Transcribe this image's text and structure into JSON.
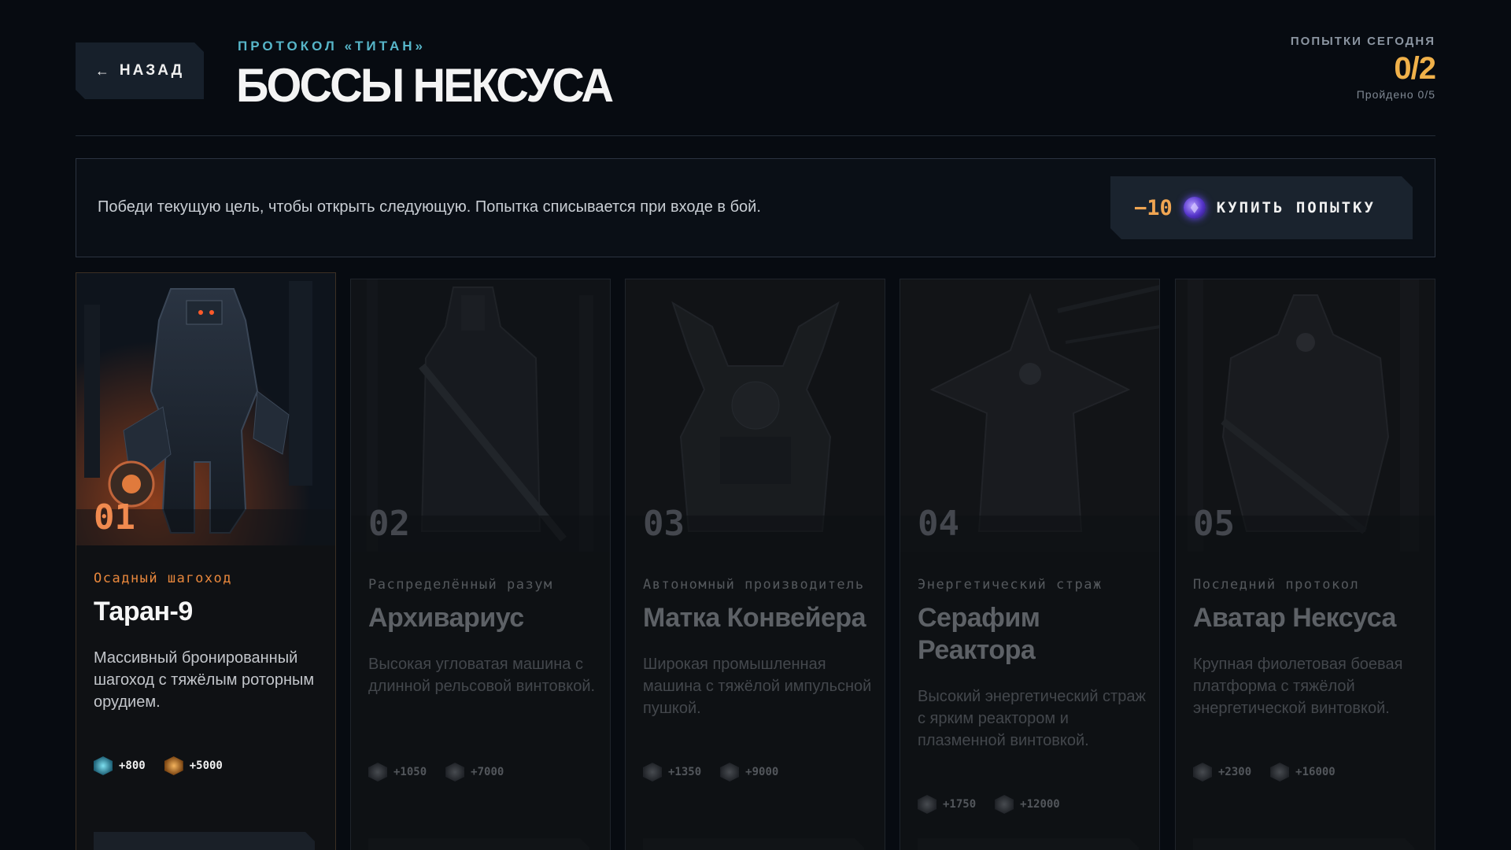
{
  "header": {
    "back_label": "НАЗАД",
    "overline": "ПРОТОКОЛ «ТИТАН»",
    "title": "БОССЫ НЕКСУСА",
    "attempts_label": "ПОПЫТКИ СЕГОДНЯ",
    "attempts_value": "0/2",
    "progress_text": "Пройдено 0/5"
  },
  "info": {
    "text": "Победи текущую цель, чтобы открыть следующую. Попытка списывается при входе в бой.",
    "buy_cost": "−10",
    "buy_label": "КУПИТЬ ПОПЫТКУ"
  },
  "bosses": [
    {
      "num": "01",
      "class": "Осадный шагоход",
      "name": "Таран-9",
      "desc": "Массивный бронированный шагоход с тяжёлым роторным орудием.",
      "xp": "+800",
      "coins": "+5000",
      "active": true
    },
    {
      "num": "02",
      "class": "Распределённый разум",
      "name": "Архивариус",
      "desc": "Высокая угловатая машина с длинной рельсовой винтовкой.",
      "xp": "+1050",
      "coins": "+7000",
      "active": false
    },
    {
      "num": "03",
      "class": "Автономный производитель",
      "name": "Матка Конвейера",
      "desc": "Широкая промышленная машина с тяжёлой импульсной пушкой.",
      "xp": "+1350",
      "coins": "+9000",
      "active": false
    },
    {
      "num": "04",
      "class": "Энергетический страж",
      "name": "Серафим Реактора",
      "desc": "Высокий энергетический страж с ярким реактором и плазменной винтовкой.",
      "xp": "+1750",
      "coins": "+12000",
      "active": false
    },
    {
      "num": "05",
      "class": "Последний протокол",
      "name": "Аватар Нексуса",
      "desc": "Крупная фиолетовая боевая платформа с тяжёлой энергетической винтовкой.",
      "xp": "+2300",
      "coins": "+16000",
      "active": false
    }
  ],
  "colors": {
    "accent_orange": "#e8873c",
    "accent_cyan": "#57b6c9",
    "gold": "#f0b14a"
  }
}
